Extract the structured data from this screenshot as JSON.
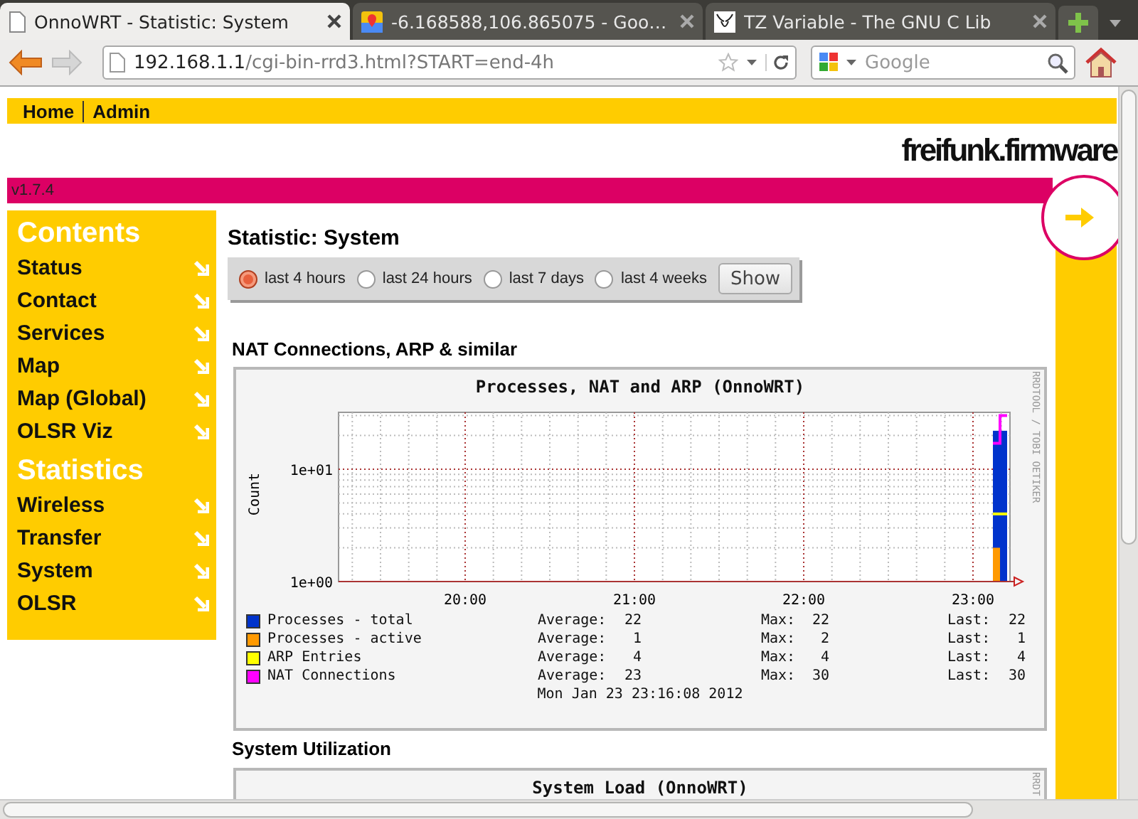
{
  "browser": {
    "tabs": [
      {
        "title": "OnnoWRT - Statistic: System",
        "selected": true
      },
      {
        "title": "-6.168588,106.865075 - Goo…",
        "selected": false
      },
      {
        "title": "TZ Variable - The GNU C Lib",
        "selected": false
      }
    ],
    "address": {
      "host": "192.168.1.1",
      "path": "/cgi-bin-rrd3.html?START=end-4h"
    },
    "search": {
      "placeholder": "Google"
    }
  },
  "page": {
    "nav": [
      {
        "label": "Home"
      },
      {
        "label": "Admin"
      }
    ],
    "logo": "freifunk.firmware",
    "version": "v1.7.4",
    "sidebar": [
      {
        "heading": "Contents",
        "items": [
          {
            "label": "Status"
          },
          {
            "label": "Contact"
          },
          {
            "label": "Services"
          },
          {
            "label": "Map"
          },
          {
            "label": "Map (Global)"
          },
          {
            "label": "OLSR Viz"
          }
        ]
      },
      {
        "heading": "Statistics",
        "items": [
          {
            "label": "Wireless"
          },
          {
            "label": "Transfer"
          },
          {
            "label": "System"
          },
          {
            "label": "OLSR"
          }
        ]
      }
    ],
    "title": "Statistic: System",
    "ranges": [
      {
        "label": "last 4 hours",
        "selected": true
      },
      {
        "label": "last 24 hours",
        "selected": false
      },
      {
        "label": "last 7 days",
        "selected": false
      },
      {
        "label": "last 4 weeks",
        "selected": false
      }
    ],
    "show_button": "Show",
    "sections": [
      {
        "heading": "NAT Connections, ARP & similar",
        "graph": {
          "title": "Processes, NAT and ARP (OnnoWRT)",
          "side_text": "RRDTOOL / TOBI OETIKER",
          "y_label": "Count",
          "y_ticks": [
            "1e+01",
            "1e+00"
          ],
          "x_ticks": [
            "20:00",
            "21:00",
            "22:00",
            "23:00"
          ],
          "legend": [
            {
              "name": "Processes - total",
              "color": "#0033cc",
              "average_label": "Average:",
              "average": "22",
              "max_label": "Max:",
              "max": "22",
              "last_label": "Last:",
              "last": "22"
            },
            {
              "name": "Processes - active",
              "color": "#ff9900",
              "average_label": "Average:",
              "average": "1",
              "max_label": "Max:",
              "max": "2",
              "last_label": "Last:",
              "last": "1"
            },
            {
              "name": "ARP Entries",
              "color": "#ffff00",
              "average_label": "Average:",
              "average": "4",
              "max_label": "Max:",
              "max": "4",
              "last_label": "Last:",
              "last": "4"
            },
            {
              "name": "NAT Connections",
              "color": "#ff00ff",
              "average_label": "Average:",
              "average": "23",
              "max_label": "Max:",
              "max": "30",
              "last_label": "Last:",
              "last": "30"
            }
          ],
          "timestamp": "Mon Jan 23 23:16:08 2012"
        }
      },
      {
        "heading": "System Utilization",
        "graph": {
          "title": "System Load (OnnoWRT)",
          "side_text": "RRDT"
        }
      }
    ]
  }
}
